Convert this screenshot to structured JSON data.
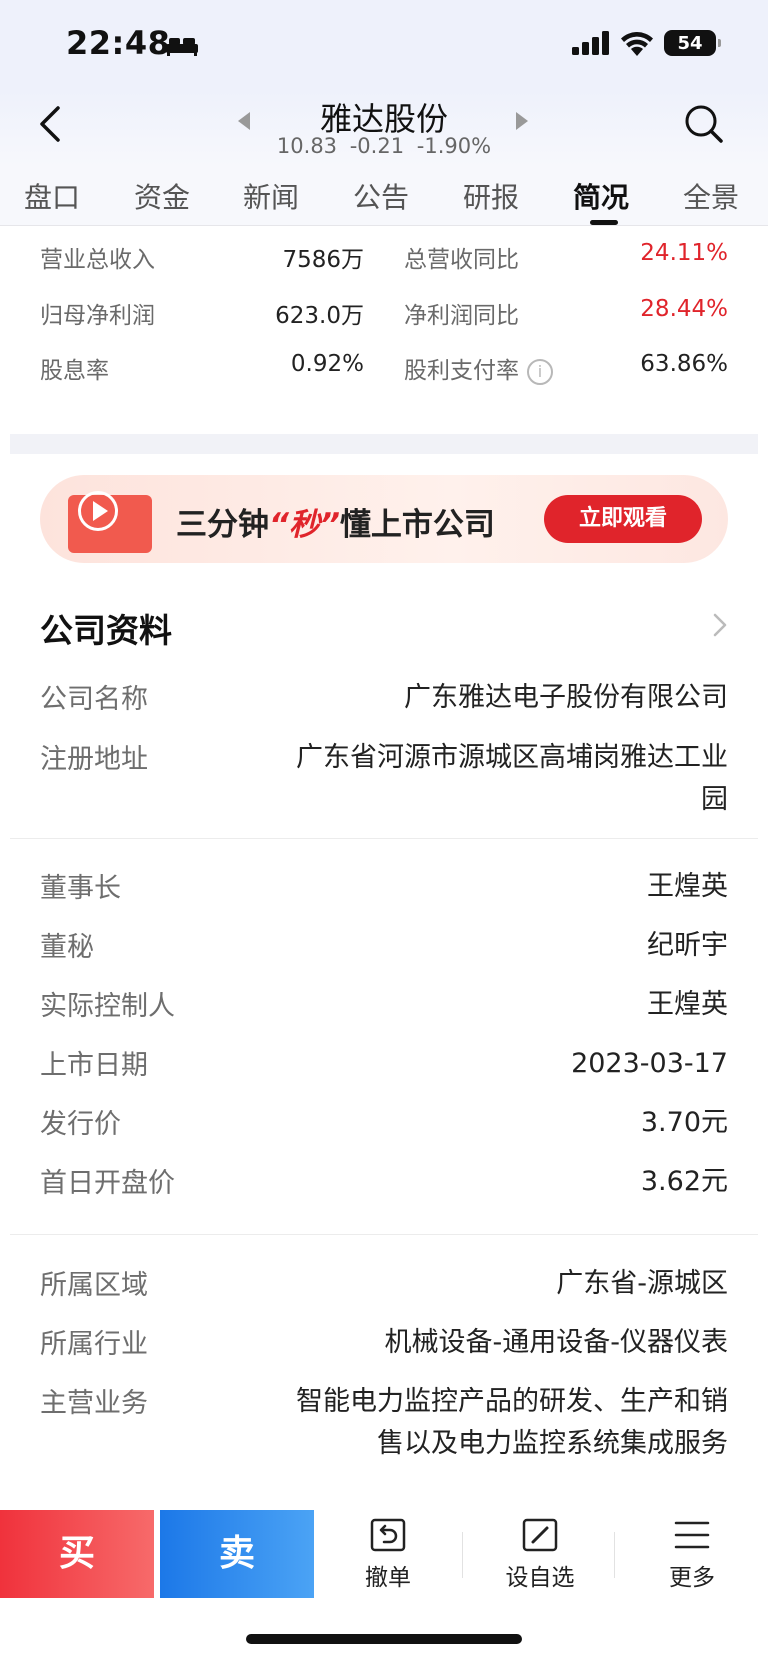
{
  "status_bar": {
    "time": "22:48",
    "battery": "54",
    "icons": [
      "bed-icon",
      "signal-icon",
      "wifi-icon",
      "battery-icon"
    ]
  },
  "header": {
    "stock_name": "雅达股份",
    "price": "10.83",
    "change": "-0.21",
    "change_pct": "-1.90%"
  },
  "tabs": [
    {
      "label": "盘口"
    },
    {
      "label": "资金"
    },
    {
      "label": "新闻"
    },
    {
      "label": "公告"
    },
    {
      "label": "研报"
    },
    {
      "label": "简况"
    },
    {
      "label": "全景"
    }
  ],
  "active_tab": "简况",
  "financials": [
    {
      "label": "营业总收入",
      "value": "7586万",
      "label2": "总营收同比",
      "value2": "24.11%"
    },
    {
      "label": "归母净利润",
      "value": "623.0万",
      "label2": "净利润同比",
      "value2": "28.44%"
    },
    {
      "label": "股息率",
      "value": "0.92%",
      "label2": "股利支付率",
      "value2": "63.86%"
    }
  ],
  "banner": {
    "text_before": "三分钟",
    "text_highlight": "“秒”",
    "text_after": "懂上市公司",
    "button": "立即观看"
  },
  "company": {
    "section_title": "公司资料",
    "name_label": "公司名称",
    "name_value": "广东雅达电子股份有限公司",
    "address_label": "注册地址",
    "address_line1": "广东省河源市源城区高埔岗雅达工业",
    "address_line2": "园",
    "chairman_label": "董事长",
    "chairman_value": "王煌英",
    "secretary_label": "董秘",
    "secretary_value": "纪昕宇",
    "controller_label": "实际控制人",
    "controller_value": "王煌英",
    "listing_date_label": "上市日期",
    "listing_date_value": "2023-03-17",
    "issue_price_label": "发行价",
    "issue_price_value": "3.70元",
    "first_open_label": "首日开盘价",
    "first_open_value": "3.62元",
    "region_label": "所属区域",
    "region_value": "广东省-源城区",
    "industry_label": "所属行业",
    "industry_value": "机械设备-通用设备-仪器仪表",
    "business_label": "主营业务",
    "business_line1": "智能电力监控产品的研发、生产和销",
    "business_line2": "售以及电力监控系统集成服务"
  },
  "bottom_bar": {
    "buy": "买",
    "sell": "卖",
    "cancel": "撤单",
    "watchlist": "设自选",
    "more": "更多"
  },
  "colors": {
    "up_red": "#e0242b",
    "sell_blue": "#1c78e8",
    "header_bg": "#eef1fb"
  }
}
